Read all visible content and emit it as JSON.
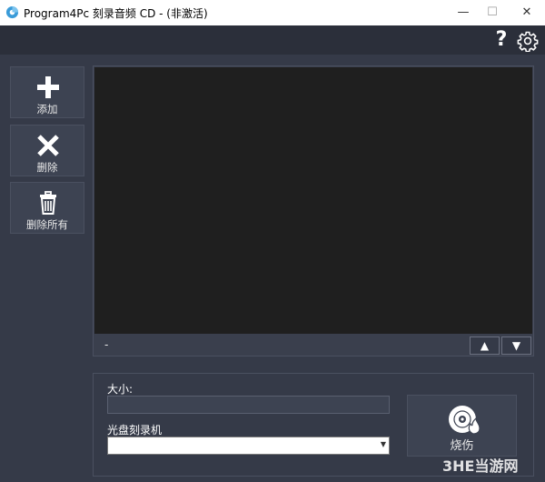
{
  "window": {
    "title": "Program4Pc 刻录音频 CD - (非激活)",
    "minimize_glyph": "—",
    "maximize_glyph": "☐",
    "close_glyph": "✕"
  },
  "toolbar": {
    "help_glyph": "?"
  },
  "sidebar": {
    "items": [
      {
        "label": "添加",
        "icon": "plus-icon"
      },
      {
        "label": "删除",
        "icon": "close-icon"
      },
      {
        "label": "删除所有",
        "icon": "trash-icon"
      }
    ]
  },
  "file_panel": {
    "status": "-",
    "up_glyph": "▲",
    "down_glyph": "▼"
  },
  "bottom": {
    "size_label": "大小:",
    "size_value": "",
    "burner_label": "光盘刻录机",
    "burner_value": "",
    "burn_label": "烧伤"
  },
  "watermark": {
    "text": "3HE当游网"
  },
  "colors": {
    "background": "#353a48",
    "topbar": "#2b2f3a",
    "list": "#1f1f1f",
    "accent": "#3a9bd8"
  }
}
